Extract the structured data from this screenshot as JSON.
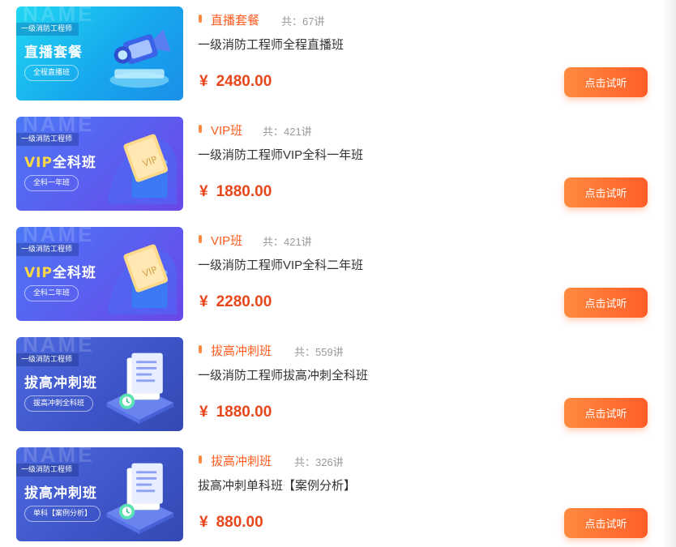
{
  "watermark": "NAME",
  "courses": [
    {
      "thumb": {
        "tag": "一级消防工程师",
        "headline": "直播套餐",
        "vip_prefix": "",
        "pill": "全程直播班"
      },
      "category": "直播套餐",
      "count": "共：67讲",
      "title": "一级消防工程师全程直播班",
      "price_symbol": "¥",
      "price": "2480.00",
      "button": "点击试听"
    },
    {
      "thumb": {
        "tag": "一级消防工程师",
        "headline": "全科班",
        "vip_prefix": "VIP",
        "pill": "全科一年班"
      },
      "category": "VIP班",
      "count": "共：421讲",
      "title": "一级消防工程师VIP全科一年班",
      "price_symbol": "¥",
      "price": "1880.00",
      "button": "点击试听"
    },
    {
      "thumb": {
        "tag": "一级消防工程师",
        "headline": "全科班",
        "vip_prefix": "VIP",
        "pill": "全科二年班"
      },
      "category": "VIP班",
      "count": "共：421讲",
      "title": "一级消防工程师VIP全科二年班",
      "price_symbol": "¥",
      "price": "2280.00",
      "button": "点击试听"
    },
    {
      "thumb": {
        "tag": "一级消防工程师",
        "headline": "拔高冲刺班",
        "vip_prefix": "",
        "pill": "拔高冲刺全科班"
      },
      "category": "拔高冲刺班",
      "count": "共：559讲",
      "title": "一级消防工程师拔高冲刺全科班",
      "price_symbol": "¥",
      "price": "1880.00",
      "button": "点击试听"
    },
    {
      "thumb": {
        "tag": "一级消防工程师",
        "headline": "拔高冲刺班",
        "vip_prefix": "",
        "pill": "单科【案例分析】"
      },
      "category": "拔高冲刺班",
      "count": "共：326讲",
      "title": "拔高冲刺单科班【案例分析】",
      "price_symbol": "¥",
      "price": "880.00",
      "button": "点击试听"
    }
  ],
  "colors": {
    "accent": "#ff5c1f",
    "price": "#e8461b",
    "button_start": "#ff8a3f",
    "button_end": "#ff5e28"
  }
}
